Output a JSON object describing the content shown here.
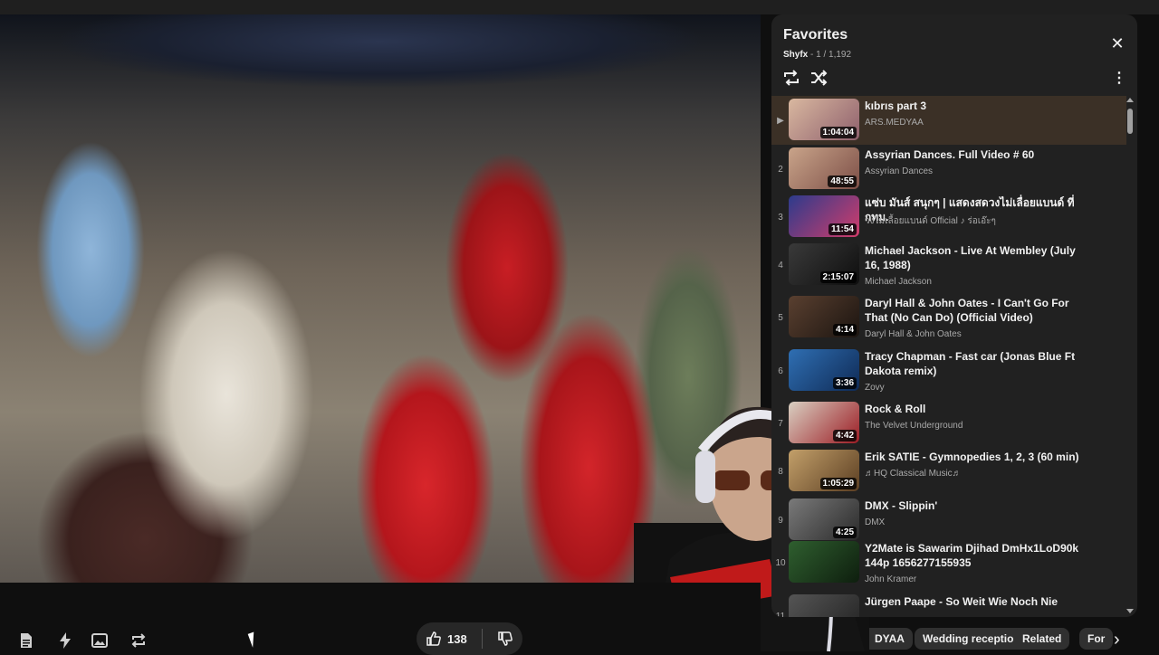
{
  "player": {
    "like_count": "138"
  },
  "panel": {
    "title": "Favorites",
    "owner": "Shyfx",
    "position": "- 1 / 1,192",
    "close_glyph": "✕",
    "more_glyph": "⋮"
  },
  "playlist": [
    {
      "index": "▶",
      "title": "kıbrıs part 3",
      "channel": "ARS.MEDYAA",
      "duration": "1:04:04",
      "active": true,
      "thumb": [
        "#d9b8a0",
        "#8e5f6c"
      ]
    },
    {
      "index": "2",
      "title": "Assyrian Dances. Full Video # 60",
      "channel": "Assyrian Dances",
      "duration": "48:55",
      "thumb": [
        "#c9a48a",
        "#7d4f47"
      ]
    },
    {
      "index": "3",
      "title": "แซ่บ มันส์ สนุกๆ | แสดงสดวงไม่เลื่อยแบนด์ ที่ กทม.",
      "channel": "วงไม่เลื้อยแบนด์ Official ♪ ร่อเอ๊ะๆ",
      "duration": "11:54",
      "thumb": [
        "#2c3b8c",
        "#d23c6b"
      ]
    },
    {
      "index": "4",
      "title": "Michael Jackson - Live At Wembley (July 16, 1988)",
      "channel": "Michael Jackson",
      "duration": "2:15:07",
      "thumb": [
        "#3a3a3a",
        "#0e0e0e"
      ]
    },
    {
      "index": "5",
      "title": "Daryl Hall & John Oates - I Can't Go For That (No Can Do) (Official Video)",
      "channel": "Daryl Hall & John Oates",
      "duration": "4:14",
      "thumb": [
        "#5a4030",
        "#1b1410"
      ]
    },
    {
      "index": "6",
      "title": "Tracy Chapman - Fast car (Jonas Blue Ft Dakota remix)",
      "channel": "Zovy",
      "duration": "3:36",
      "thumb": [
        "#2f6fb3",
        "#0f2a55"
      ]
    },
    {
      "index": "7",
      "title": "Rock & Roll",
      "channel": "The Velvet Underground",
      "duration": "4:42",
      "thumb": [
        "#d9d0c2",
        "#9c1c24"
      ]
    },
    {
      "index": "8",
      "title": "Erik SATIE - Gymnopedies 1, 2, 3 (60 min)",
      "channel": "♬HQ Classical Music♬",
      "duration": "1:05:29",
      "thumb": [
        "#c3a06a",
        "#5b3e22"
      ]
    },
    {
      "index": "9",
      "title": "DMX - Slippin'",
      "channel": "DMX",
      "duration": "4:25",
      "thumb": [
        "#7a7a7a",
        "#2a2a2a"
      ]
    },
    {
      "index": "10",
      "title": "Y2Mate is Sawarim Djihad DmHx1LoD90k 144p 1656277155935",
      "channel": "John Kramer",
      "duration": "",
      "thumb": [
        "#2f5f2f",
        "#0e1e0e"
      ]
    },
    {
      "index": "11",
      "title": "Jürgen Paape - So Weit Wie Noch Nie",
      "channel": "",
      "duration": "",
      "thumb": [
        "#555555",
        "#222222"
      ]
    }
  ],
  "chips": [
    "DYAA",
    "Wedding reception",
    "Related",
    "For"
  ],
  "colors": {
    "panel_bg": "#212121",
    "active_row": "#3b3026",
    "chip_bg": "#303030",
    "page_bg": "#0f0f0f"
  }
}
